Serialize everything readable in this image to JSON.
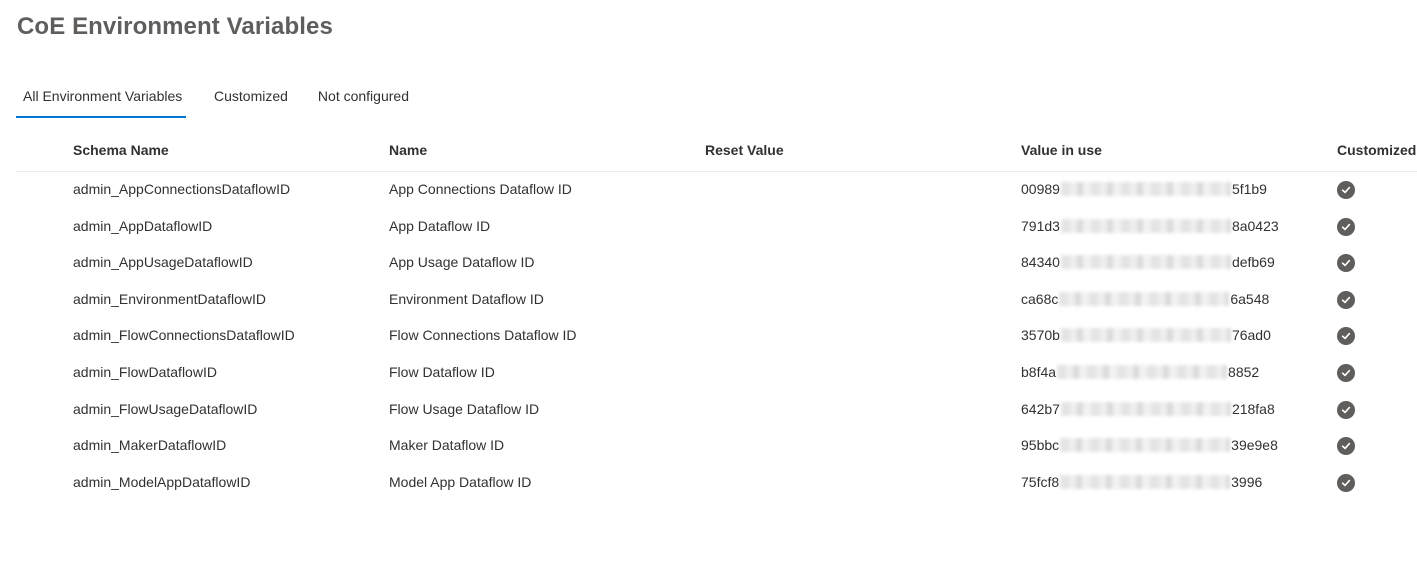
{
  "page": {
    "title": "CoE Environment Variables"
  },
  "tabs": [
    {
      "label": "All Environment Variables",
      "active": true
    },
    {
      "label": "Customized",
      "active": false
    },
    {
      "label": "Not configured",
      "active": false
    }
  ],
  "grid": {
    "columns": {
      "schema_name": "Schema Name",
      "name": "Name",
      "reset_value": "Reset Value",
      "value_in_use": "Value in use",
      "customized": "Customized"
    },
    "rows": [
      {
        "schema_name": "admin_AppConnectionsDataflowID",
        "name": "App Connections Dataflow ID",
        "reset_value": "",
        "value_prefix": "00989",
        "value_suffix": "5f1b9",
        "customized_icon": "checkmark-circle-icon"
      },
      {
        "schema_name": "admin_AppDataflowID",
        "name": "App Dataflow ID",
        "reset_value": "",
        "value_prefix": "791d3",
        "value_suffix": "8a0423",
        "customized_icon": "checkmark-circle-icon"
      },
      {
        "schema_name": "admin_AppUsageDataflowID",
        "name": "App Usage Dataflow ID",
        "reset_value": "",
        "value_prefix": "84340",
        "value_suffix": "defb69",
        "customized_icon": "checkmark-circle-icon"
      },
      {
        "schema_name": "admin_EnvironmentDataflowID",
        "name": "Environment Dataflow ID",
        "reset_value": "",
        "value_prefix": "ca68c",
        "value_suffix": "6a548",
        "customized_icon": "checkmark-circle-icon"
      },
      {
        "schema_name": "admin_FlowConnectionsDataflowID",
        "name": "Flow Connections Dataflow ID",
        "reset_value": "",
        "value_prefix": "3570b",
        "value_suffix": "76ad0",
        "customized_icon": "checkmark-circle-icon"
      },
      {
        "schema_name": "admin_FlowDataflowID",
        "name": "Flow Dataflow ID",
        "reset_value": "",
        "value_prefix": "b8f4a",
        "value_suffix": "8852",
        "customized_icon": "checkmark-circle-icon"
      },
      {
        "schema_name": "admin_FlowUsageDataflowID",
        "name": "Flow Usage Dataflow ID",
        "reset_value": "",
        "value_prefix": "642b7",
        "value_suffix": "218fa8",
        "customized_icon": "checkmark-circle-icon"
      },
      {
        "schema_name": "admin_MakerDataflowID",
        "name": "Maker Dataflow ID",
        "reset_value": "",
        "value_prefix": "95bbc",
        "value_suffix": "39e9e8",
        "customized_icon": "checkmark-circle-icon"
      },
      {
        "schema_name": "admin_ModelAppDataflowID",
        "name": "Model App Dataflow ID",
        "reset_value": "",
        "value_prefix": "75fcf8",
        "value_suffix": "3996",
        "customized_icon": "checkmark-circle-icon"
      }
    ]
  },
  "colors": {
    "accent": "#0078d4",
    "title": "#605e5c",
    "text": "#323130",
    "check_icon": "#605e5c"
  }
}
